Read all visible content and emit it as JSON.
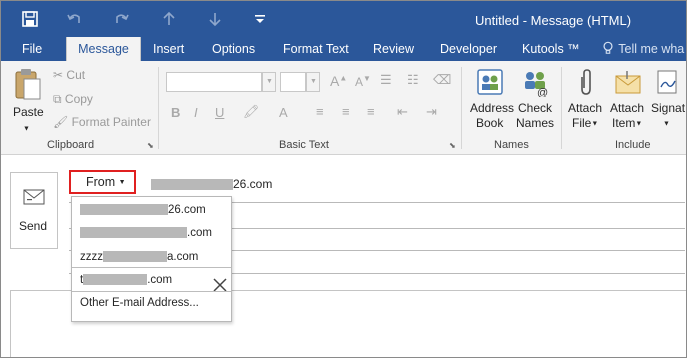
{
  "window": {
    "title": "Untitled  -  Message (HTML)"
  },
  "quick_access": [
    {
      "name": "save-icon"
    },
    {
      "name": "undo-icon"
    },
    {
      "name": "redo-icon"
    },
    {
      "name": "arrow-up-icon"
    },
    {
      "name": "arrow-down-icon"
    },
    {
      "name": "customize-qat-icon"
    }
  ],
  "tabs": [
    "File",
    "Message",
    "Insert",
    "Options",
    "Format Text",
    "Review",
    "Developer",
    "Kutools ™"
  ],
  "active_tab": "Message",
  "tell_me": "Tell me wha",
  "ribbon": {
    "clipboard": {
      "paste": "Paste",
      "cut": "Cut",
      "copy": "Copy",
      "format_painter": "Format Painter",
      "label": "Clipboard"
    },
    "basic_text": {
      "bold": "B",
      "italic": "I",
      "underline": "U",
      "label": "Basic Text"
    },
    "names": {
      "address_book_1": "Address",
      "address_book_2": "Book",
      "check_names_1": "Check",
      "check_names_2": "Names",
      "label": "Names"
    },
    "include": {
      "attach_file_1": "Attach",
      "attach_file_2": "File",
      "attach_item_1": "Attach",
      "attach_item_2": "Item",
      "signature": "Signat",
      "label": "Include"
    }
  },
  "compose": {
    "send": "Send",
    "from": "From",
    "from_address_suffix": "26.com"
  },
  "from_dropdown": {
    "items": [
      {
        "suffix": "26.com"
      },
      {
        "suffix": ".com"
      },
      {
        "prefix": "zzzz",
        "suffix": "a.com"
      },
      {
        "prefix": "t",
        "suffix": ".com"
      }
    ],
    "other": "Other E-mail Address..."
  },
  "colors": {
    "brand": "#2b579a",
    "highlight_border": "#e02020"
  }
}
